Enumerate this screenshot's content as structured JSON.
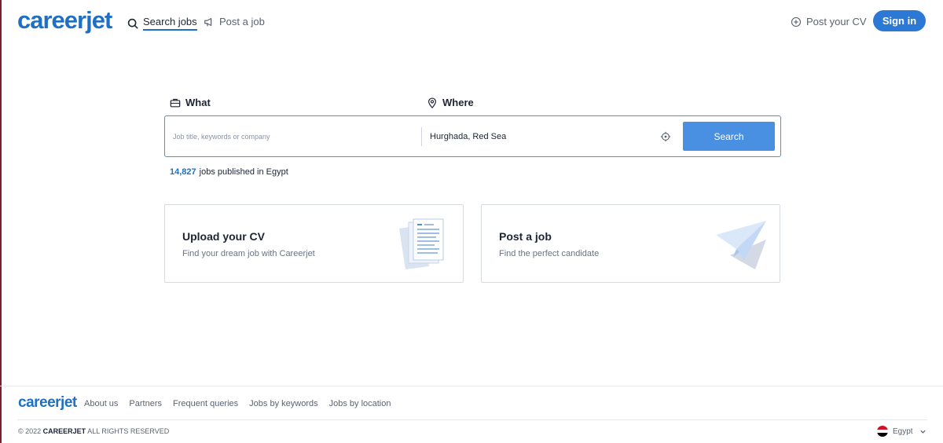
{
  "colors": {
    "brand": "#1f6fc5",
    "button": "#4a90e2",
    "sign_in": "#2b78d5"
  },
  "header": {
    "logo": "careerjet",
    "nav": [
      {
        "label": "Search jobs",
        "icon": "search-icon"
      },
      {
        "label": "Post a job",
        "icon": "megaphone-icon"
      }
    ],
    "post_cv": {
      "label": "Post your CV",
      "icon": "plus-circle-icon"
    },
    "sign_in": "Sign in"
  },
  "search": {
    "what_label": "What",
    "what_icon": "briefcase-icon",
    "what_placeholder": "Job title, keywords or company",
    "what_value": "",
    "where_label": "Where",
    "where_icon": "map-pin-icon",
    "where_value": "Hurghada, Red Sea",
    "locate_icon": "crosshair-icon",
    "button": "Search"
  },
  "jobs_count": {
    "number": "14,827",
    "text": "jobs published in Egypt"
  },
  "cards": [
    {
      "title": "Upload your CV",
      "subtitle": "Find your dream job with Careerjet",
      "icon": "document-stack-icon"
    },
    {
      "title": "Post a job",
      "subtitle": "Find the perfect candidate",
      "icon": "paper-plane-icon"
    }
  ],
  "footer": {
    "logo": "careerjet",
    "links": [
      "About us",
      "Partners",
      "Frequent queries",
      "Jobs by keywords",
      "Jobs by location"
    ],
    "copyright_prefix": "© 2022",
    "copyright_brand": "CAREERJET",
    "copyright_suffix": "ALL RIGHTS RESERVED",
    "country": "Egypt",
    "country_icon": "egypt-flag-icon"
  }
}
